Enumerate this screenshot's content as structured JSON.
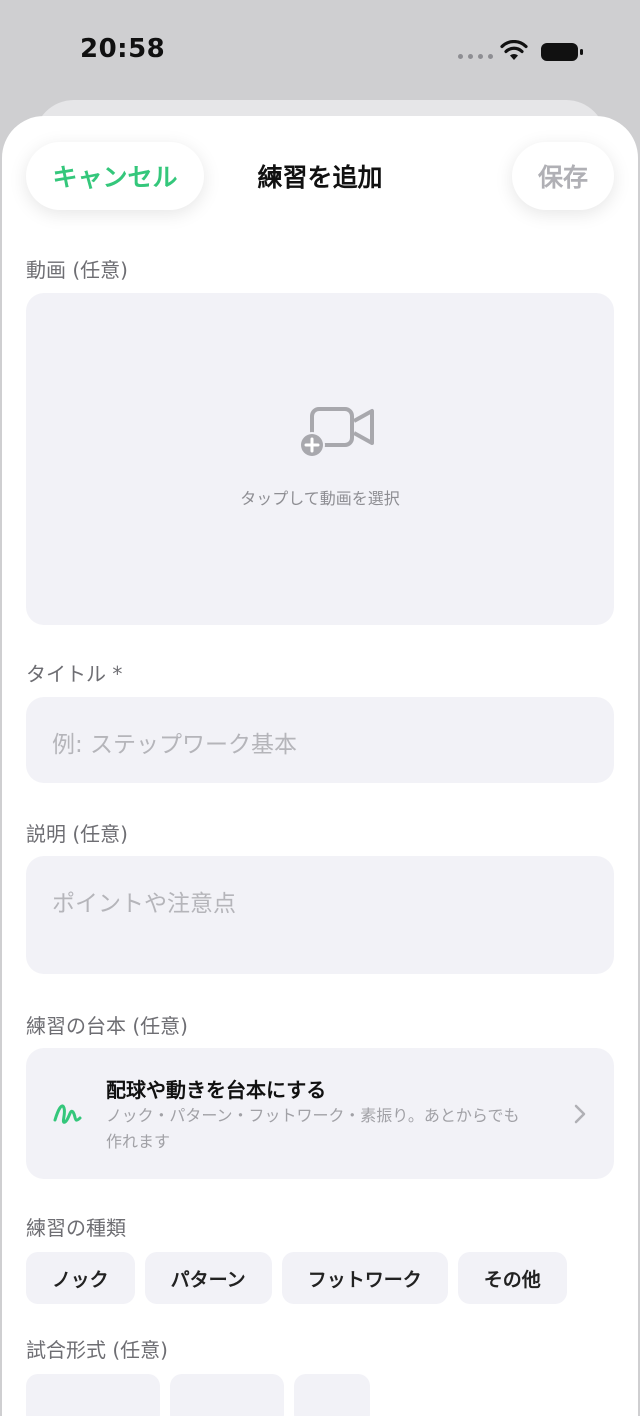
{
  "status_bar": {
    "time": "20:58"
  },
  "nav": {
    "cancel_label": "キャンセル",
    "title": "練習を追加",
    "save_label": "保存"
  },
  "video": {
    "label": "動画 (任意)",
    "hint": "タップして動画を選択"
  },
  "title_field": {
    "label": "タイトル *",
    "placeholder": "例: ステップワーク基本"
  },
  "description_field": {
    "label": "説明 (任意)",
    "placeholder": "ポイントや注意点"
  },
  "script": {
    "label": "練習の台本 (任意)",
    "title": "配球や動きを台本にする",
    "description": "ノック・パターン・フットワーク・素振り。あとからでも作れます"
  },
  "practice_type": {
    "label": "練習の種類",
    "options": [
      "ノック",
      "パターン",
      "フットワーク",
      "その他"
    ]
  },
  "match_format": {
    "label": "試合形式 (任意)"
  },
  "colors": {
    "accent": "#34c77b",
    "field_bg": "#f2f2f7"
  }
}
